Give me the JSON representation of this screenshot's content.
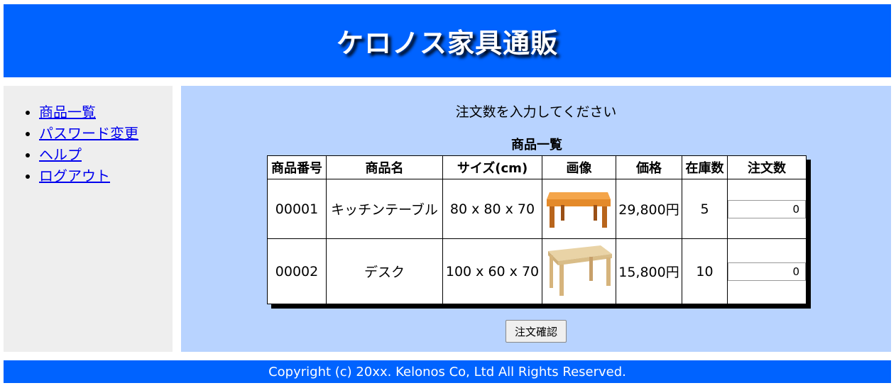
{
  "header": {
    "title": "ケロノス家具通販"
  },
  "sidebar": {
    "items": [
      {
        "label": "商品一覧"
      },
      {
        "label": "パスワード変更"
      },
      {
        "label": "ヘルプ"
      },
      {
        "label": "ログアウト"
      }
    ]
  },
  "main": {
    "instruction": "注文数を入力してください",
    "table_caption": "商品一覧",
    "columns": [
      "商品番号",
      "商品名",
      "サイズ(cm)",
      "画像",
      "価格",
      "在庫数",
      "注文数"
    ],
    "rows": [
      {
        "id": "00001",
        "name": "キッチンテーブル",
        "size": "80 x 80 x 70",
        "image": "table-image",
        "price": "29,800円",
        "stock": "5",
        "qty": "0"
      },
      {
        "id": "00002",
        "name": "デスク",
        "size": "100 x 60 x 70",
        "image": "desk-image",
        "price": "15,800円",
        "stock": "10",
        "qty": "0"
      }
    ],
    "submit_label": "注文確認"
  },
  "footer": {
    "copyright": "Copyright (c) 20xx. Kelonos Co, Ltd All Rights Reserved."
  },
  "colors": {
    "header_bg": "#0063ff",
    "main_bg": "#b8d3ff",
    "sidebar_bg": "#eeeeee"
  }
}
